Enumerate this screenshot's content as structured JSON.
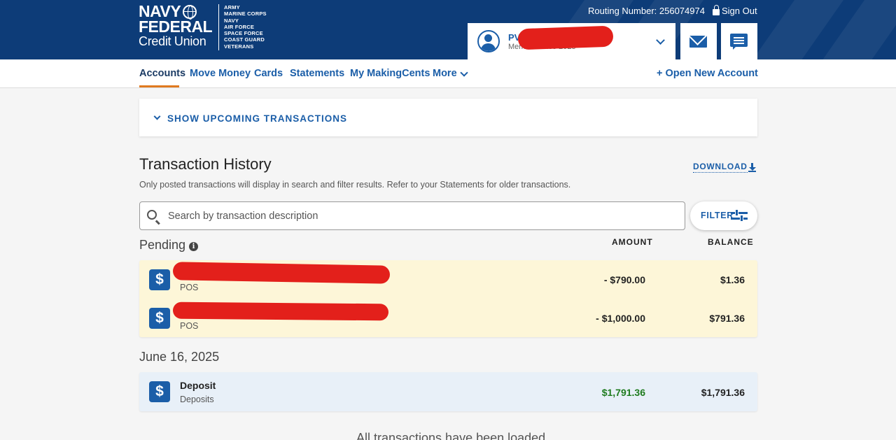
{
  "header": {
    "logo": {
      "line1": "NAVY",
      "line2": "FEDERAL",
      "line3": "Credit Union"
    },
    "branches": [
      "ARMY",
      "MARINE CORPS",
      "NAVY",
      "AIR FORCE",
      "SPACE FORCE",
      "COAST GUARD",
      "VETERANS"
    ],
    "routing_label": "Routing Number: 256074974",
    "signout_label": "Sign Out",
    "member": {
      "name_visible": "PV",
      "since": "Member since 2025"
    }
  },
  "nav": {
    "items": [
      "Accounts",
      "Move Money",
      "Cards",
      "Statements",
      "My MakingCents",
      "More"
    ],
    "active": "Accounts",
    "open_account": "+ Open New Account"
  },
  "upcoming": {
    "label": "SHOW UPCOMING TRANSACTIONS"
  },
  "history": {
    "title": "Transaction History",
    "download": "DOWNLOAD",
    "note": "Only posted transactions will display in search and filter results. Refer to your Statements for older transactions.",
    "search_placeholder": "Search by transaction description",
    "filter": "FILTER",
    "columns": {
      "amount": "AMOUNT",
      "balance": "BALANCE"
    },
    "pending_label": "Pending",
    "pending": [
      {
        "description": "",
        "category": "POS",
        "amount": "- $790.00",
        "balance": "$1.36"
      },
      {
        "description": "",
        "category": "POS",
        "amount": "- $1,000.00",
        "balance": "$791.36"
      }
    ],
    "date_label": "June 16, 2025",
    "posted": [
      {
        "description": "Deposit",
        "category": "Deposits",
        "amount": "$1,791.36",
        "balance": "$1,791.36"
      }
    ],
    "loaded_message": "All transactions have been loaded"
  },
  "colors": {
    "brand_navy": "#0d3c78",
    "link_blue": "#1b5ea8",
    "accent_orange": "#e07a1f",
    "pending_bg": "#fdf6d8",
    "posted_bg": "#e8f0f8",
    "credit_green": "#1e7b1e",
    "redaction": "#e3201b"
  }
}
